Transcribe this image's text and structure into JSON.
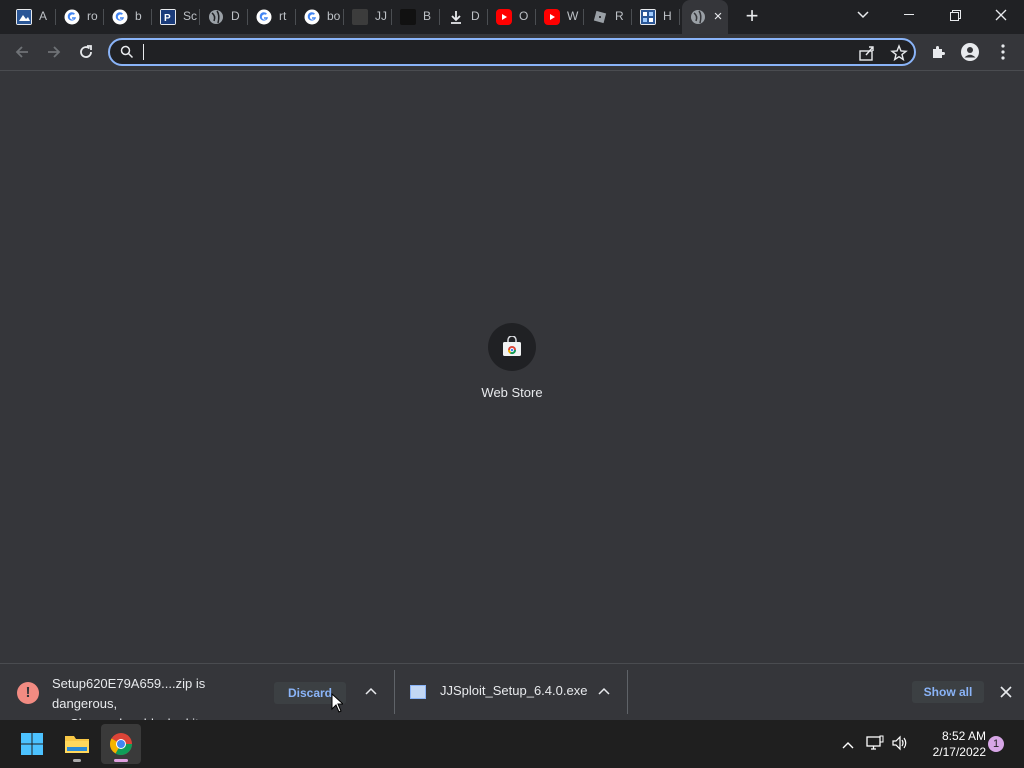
{
  "tabs": [
    {
      "title": "A",
      "icon": "image-favicon-icon"
    },
    {
      "title": "ro",
      "icon": "google-icon"
    },
    {
      "title": "b",
      "icon": "google-icon"
    },
    {
      "title": "Sc",
      "icon": "pdf-favicon-icon"
    },
    {
      "title": "D",
      "icon": "globe-icon"
    },
    {
      "title": "rt",
      "icon": "google-icon"
    },
    {
      "title": "bo",
      "icon": "google-icon"
    },
    {
      "title": "JJ",
      "icon": "dark-favicon-icon"
    },
    {
      "title": "B",
      "icon": "dark-round-favicon-icon"
    },
    {
      "title": "D",
      "icon": "download-icon"
    },
    {
      "title": "O",
      "icon": "youtube-icon"
    },
    {
      "title": "W",
      "icon": "youtube-icon"
    },
    {
      "title": "R",
      "icon": "roblox-icon"
    },
    {
      "title": "H",
      "icon": "grid-favicon-icon"
    }
  ],
  "active_tab": {
    "icon": "globe-icon",
    "close": "×"
  },
  "omnibox": {
    "value": "",
    "placeholder": ""
  },
  "shortcut": {
    "label": "Web Store"
  },
  "download_shelf": {
    "blocked_item": {
      "text_line1": "Setup620E79A659....zip is dangerous,",
      "text_line2": "so Chrome has blocked it.",
      "discard_label": "Discard"
    },
    "file_item": {
      "name": "JJSploit_Setup_6.4.0.exe"
    },
    "show_all_label": "Show all"
  },
  "taskbar": {
    "time": "8:52 AM",
    "date": "2/17/2022",
    "notification_count": "1"
  },
  "colors": {
    "accent": "#8ab4f8",
    "danger": "#f28b82",
    "frame": "#202124",
    "toolbar": "#35363a"
  }
}
